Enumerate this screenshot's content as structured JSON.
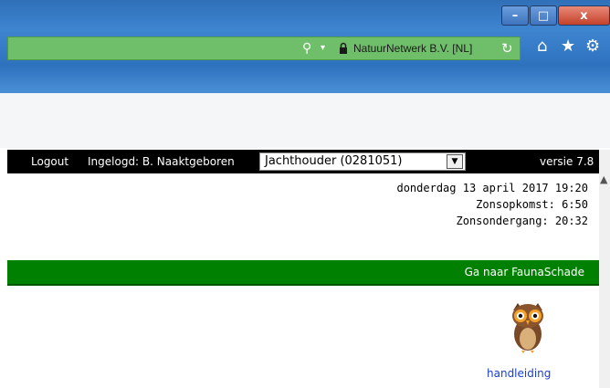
{
  "browser": {
    "window_controls": {
      "minimize": "–",
      "maximize": "□",
      "close": "x"
    },
    "address": {
      "site_identity": "NatuurNetwerk B.V. [NL]",
      "icons": [
        "search-icon",
        "dropdown-icon",
        "lock-icon",
        "reload-icon"
      ]
    },
    "toolbar_icons": [
      "home-icon",
      "favorites-star-icon",
      "settings-gear-icon"
    ]
  },
  "topbar": {
    "logout": "Logout",
    "user": "Ingelogd: B. Naaktgeboren",
    "role_select": "Jachthouder (0281051)",
    "version": "versie 7.8"
  },
  "info": {
    "date": "donderdag 13 april 2017 19:20",
    "sunrise": "Zonsopkomst: 6:50",
    "sunset": "Zonsondergang: 20:32"
  },
  "greenbar": {
    "link": "Ga naar FaunaSchade"
  },
  "manual": {
    "label": "handleiding"
  },
  "colors": {
    "greenbar": "#008000",
    "topbar": "#000000",
    "link": "#1a3fd0"
  }
}
